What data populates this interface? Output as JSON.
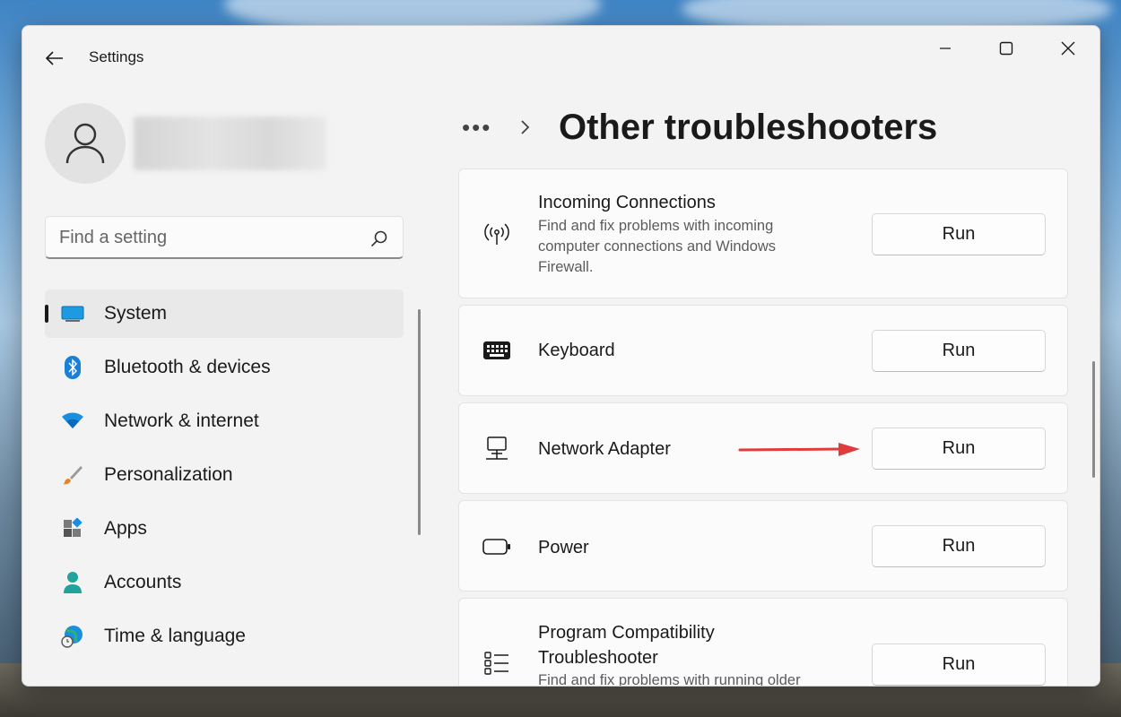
{
  "window": {
    "title": "Settings"
  },
  "sidebar": {
    "search_placeholder": "Find a setting",
    "items": [
      {
        "label": "System",
        "active": true
      },
      {
        "label": "Bluetooth & devices"
      },
      {
        "label": "Network & internet"
      },
      {
        "label": "Personalization"
      },
      {
        "label": "Apps"
      },
      {
        "label": "Accounts"
      },
      {
        "label": "Time & language"
      }
    ]
  },
  "main": {
    "breadcrumb_overflow": "•••",
    "title": "Other troubleshooters",
    "run_label": "Run",
    "troubleshooters": [
      {
        "title": "Incoming Connections",
        "description": "Find and fix problems with incoming computer connections and Windows Firewall.",
        "icon": "antenna-icon"
      },
      {
        "title": "Keyboard",
        "icon": "keyboard-icon"
      },
      {
        "title": "Network Adapter",
        "icon": "network-computer-icon"
      },
      {
        "title": "Power",
        "icon": "battery-icon"
      },
      {
        "title": "Program Compatibility Troubleshooter",
        "description": "Find and fix problems with running older",
        "icon": "list-icon"
      }
    ]
  },
  "colors": {
    "accent": "#0067c0",
    "annotation_arrow": "#e03c3c"
  }
}
